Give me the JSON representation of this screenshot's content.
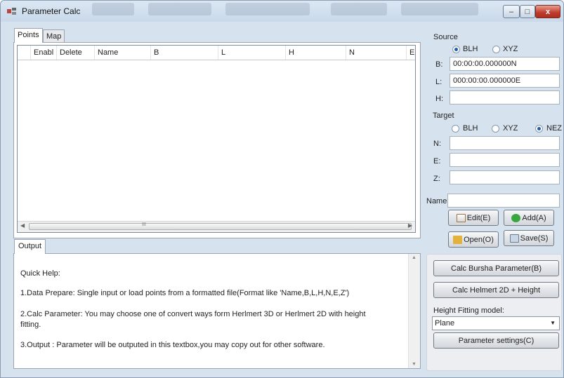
{
  "window": {
    "title": "Parameter Calc",
    "controls": {
      "minimize": "–",
      "maximize": "□",
      "close": "x"
    }
  },
  "tabs": {
    "points": "Points",
    "map": "Map",
    "output": "Output"
  },
  "grid": {
    "columns": [
      "Enabl",
      "Delete",
      "Name",
      "B",
      "L",
      "H",
      "N",
      "E"
    ],
    "scroll_mark": "III"
  },
  "quick_help": {
    "heading": "Quick Help:",
    "lines": [
      "1.Data Prepare: Single input or load points from a formatted file(Format like 'Name,B,L,H,N,E,Z')",
      "2.Calc Parameter: You may choose one of convert ways form Herlmert 3D or Herlmert 2D with height",
      "fitting.",
      "3.Output : Parameter will be outputed in this textbox,you may copy out for other software."
    ]
  },
  "source": {
    "title": "Source",
    "radios": [
      "BLH",
      "XYZ"
    ],
    "selected": "BLH",
    "fields": [
      {
        "label": "B:",
        "value": "00:00:00.000000N"
      },
      {
        "label": "L:",
        "value": "000:00:00.000000E"
      },
      {
        "label": "H:",
        "value": ""
      }
    ]
  },
  "target": {
    "title": "Target",
    "radios": [
      "BLH",
      "XYZ",
      "NEZ"
    ],
    "selected": "NEZ",
    "fields": [
      {
        "label": "N:",
        "value": ""
      },
      {
        "label": "E:",
        "value": ""
      },
      {
        "label": "Z:",
        "value": ""
      }
    ]
  },
  "name": {
    "label": "Name",
    "value": ""
  },
  "buttons": {
    "edit": "Edit(E)",
    "add": "Add(A)",
    "open": "Open(O)",
    "save": "Save(S)",
    "calc_bursha": "Calc Bursha Parameter(B)",
    "calc_helmert": "Calc Helmert 2D + Height",
    "param_settings": "Parameter settings(C)"
  },
  "height_fitting": {
    "label": "Height Fitting model:",
    "selected": "Plane"
  },
  "icons": {
    "app": "app-icon",
    "edit": "edit-icon",
    "add": "add-icon",
    "open": "folder-icon",
    "save": "save-icon"
  },
  "colors": {
    "selected_radio": "#1e5bb3",
    "close_button": "#c0392b",
    "add_icon": "#3aa640",
    "folder_icon": "#e3b23c"
  }
}
